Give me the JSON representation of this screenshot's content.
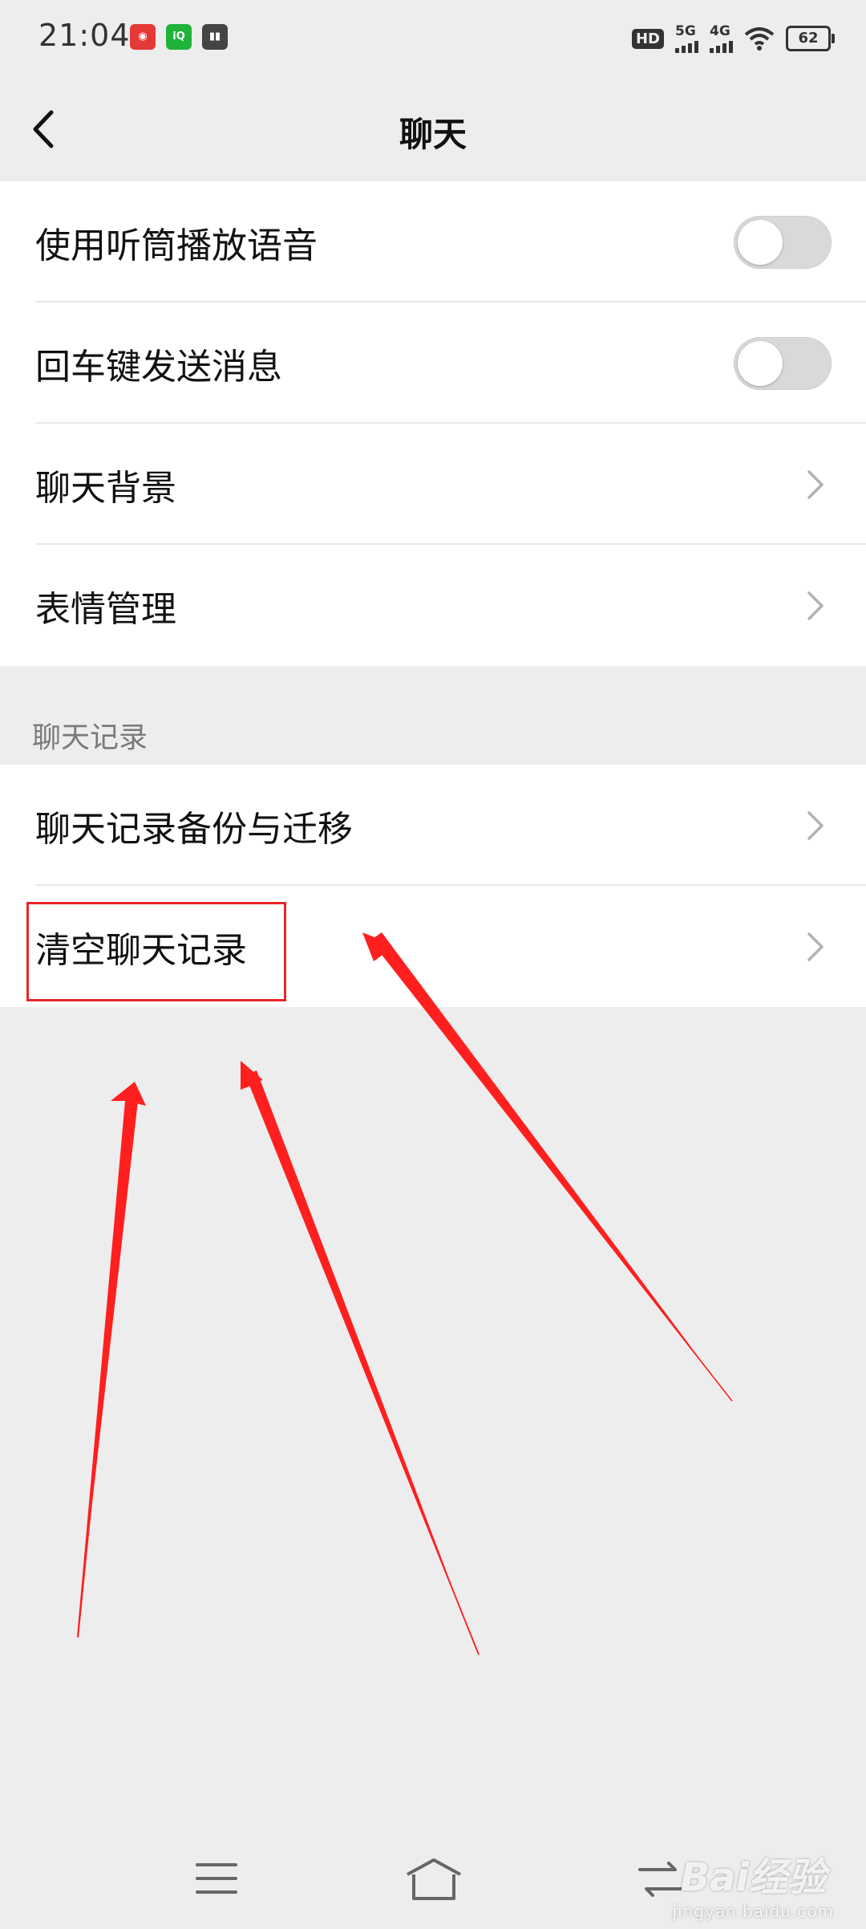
{
  "status_bar": {
    "time": "21:04",
    "app_icons": [
      "netease-music-icon",
      "iqiyi-icon",
      "book-icon"
    ],
    "hd_label": "HD",
    "network_1": "5G",
    "network_2": "4G",
    "battery": "62"
  },
  "header": {
    "title": "聊天"
  },
  "group1": {
    "items": [
      {
        "label": "使用听筒播放语音",
        "type": "toggle",
        "on": false
      },
      {
        "label": "回车键发送消息",
        "type": "toggle",
        "on": false
      },
      {
        "label": "聊天背景",
        "type": "link"
      },
      {
        "label": "表情管理",
        "type": "link"
      }
    ]
  },
  "section2": {
    "header": "聊天记录"
  },
  "group2": {
    "items": [
      {
        "label": "聊天记录备份与迁移",
        "type": "link"
      },
      {
        "label": "清空聊天记录",
        "type": "link"
      }
    ]
  },
  "annotation": {
    "highlight_color": "#e8262a"
  },
  "watermark": {
    "main": "Bai经验",
    "sub": "jingyan.baidu.com"
  }
}
